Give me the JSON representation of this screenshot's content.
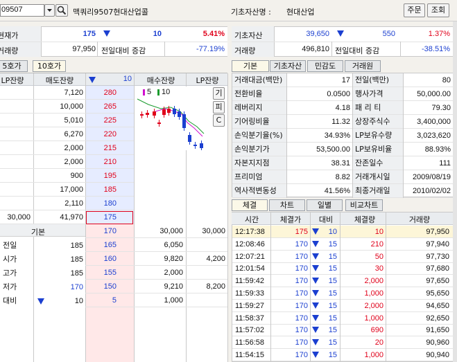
{
  "top": {
    "code": "09507",
    "name": "맥쿼리9507현대산업콜",
    "underlying_label": "기초자산명 :",
    "underlying_value": "현대산업",
    "btn_order": "주문",
    "btn_inquiry": "조회"
  },
  "left_info": {
    "price_label": "현재가",
    "price": "175",
    "change": "10",
    "rate": "5.41%",
    "volume_label": "거래량",
    "volume": "97,950",
    "prev_label": "전일대비 증감",
    "prev_rate": "-77.19%"
  },
  "right_info": {
    "asset_label": "기초자산",
    "asset_price": "39,650",
    "asset_change": "550",
    "asset_rate": "1.37%",
    "volume_label": "거래량",
    "volume": "496,810",
    "prev_label": "전일대비 증감",
    "prev_rate": "-38.51%"
  },
  "hoga_tabs": [
    "5호가",
    "10호가"
  ],
  "orderbook": {
    "headers": [
      "LP잔량",
      "매도잔량",
      "10",
      "매수잔량",
      "LP잔량"
    ],
    "asks": [
      {
        "lp": "",
        "qty": "7,120",
        "price": "280"
      },
      {
        "lp": "",
        "qty": "10,000",
        "price": "265"
      },
      {
        "lp": "",
        "qty": "5,010",
        "price": "225"
      },
      {
        "lp": "",
        "qty": "6,270",
        "price": "220"
      },
      {
        "lp": "",
        "qty": "2,000",
        "price": "215"
      },
      {
        "lp": "",
        "qty": "2,000",
        "price": "210"
      },
      {
        "lp": "",
        "qty": "900",
        "price": "195"
      },
      {
        "lp": "",
        "qty": "17,000",
        "price": "185"
      },
      {
        "lp": "",
        "qty": "2,110",
        "price": "180"
      },
      {
        "lp": "30,000",
        "qty": "41,970",
        "price": "175"
      }
    ],
    "bids": [
      {
        "price": "170",
        "qty": "30,000",
        "lp": "30,000"
      },
      {
        "price": "165",
        "qty": "6,050",
        "lp": ""
      },
      {
        "price": "160",
        "qty": "9,820",
        "lp": "4,200"
      },
      {
        "price": "155",
        "qty": "2,000",
        "lp": ""
      },
      {
        "price": "150",
        "qty": "9,210",
        "lp": "8,200"
      },
      {
        "price": "5",
        "qty": "1,000",
        "lp": ""
      }
    ],
    "basic_label": "기본",
    "basic_rows": [
      {
        "label": "전일",
        "value": "185"
      },
      {
        "label": "시가",
        "value": "185"
      },
      {
        "label": "고가",
        "value": "185"
      },
      {
        "label": "저가",
        "value": "170"
      },
      {
        "label": "대비",
        "value": "10"
      }
    ],
    "mini_legend_5": "5",
    "mini_legend_10": "10",
    "side_buttons": [
      "기",
      "피",
      "C"
    ]
  },
  "info_tabs": [
    "기본",
    "기초자산",
    "민감도",
    "거래원"
  ],
  "info_table": [
    {
      "l1": "거래대금(백만)",
      "v1": "17",
      "l2": "전일(백만)",
      "v2": "80"
    },
    {
      "l1": "전환비율",
      "v1": "0.0500",
      "l2": "행사가격",
      "v2": "50,000.00"
    },
    {
      "l1": "레버리지",
      "v1": "4.18",
      "l2": "패 리 티",
      "v2": "79.30"
    },
    {
      "l1": "기어링비율",
      "v1": "11.32",
      "l2": "상장주식수",
      "v2": "3,400,000"
    },
    {
      "l1": "손익분기율(%)",
      "v1": "34.93%",
      "l2": "LP보유수량",
      "v2": "3,023,620"
    },
    {
      "l1": "손익분기가",
      "v1": "53,500.00",
      "l2": "LP보유비율",
      "v2": "88.93%"
    },
    {
      "l1": "자본지지점",
      "v1": "38.31",
      "l2": "잔존일수",
      "v2": "111"
    },
    {
      "l1": "프리미엄",
      "v1": "8.82",
      "l2": "거래개시일",
      "v2": "2009/08/19"
    },
    {
      "l1": "역사적변동성",
      "v1": "41.56%",
      "l2": "최종거래일",
      "v2": "2010/02/02"
    }
  ],
  "trade_tabs": [
    "체결",
    "차트",
    "일별",
    "비교차트"
  ],
  "trades": {
    "headers": [
      "시간",
      "체결가",
      "대비",
      "체결량",
      "거래량"
    ],
    "rows": [
      {
        "time": "12:17:38",
        "price": "175",
        "chg": "10",
        "qty": "10",
        "vol": "97,950"
      },
      {
        "time": "12:08:46",
        "price": "170",
        "chg": "15",
        "qty": "210",
        "vol": "97,940"
      },
      {
        "time": "12:07:21",
        "price": "170",
        "chg": "15",
        "qty": "50",
        "vol": "97,730"
      },
      {
        "time": "12:01:54",
        "price": "170",
        "chg": "15",
        "qty": "30",
        "vol": "97,680"
      },
      {
        "time": "11:59:42",
        "price": "170",
        "chg": "15",
        "qty": "2,000",
        "vol": "97,650"
      },
      {
        "time": "11:59:33",
        "price": "170",
        "chg": "15",
        "qty": "1,000",
        "vol": "95,650"
      },
      {
        "time": "11:59:27",
        "price": "170",
        "chg": "15",
        "qty": "2,000",
        "vol": "94,650"
      },
      {
        "time": "11:58:37",
        "price": "170",
        "chg": "15",
        "qty": "1,000",
        "vol": "92,650"
      },
      {
        "time": "11:57:02",
        "price": "170",
        "chg": "15",
        "qty": "690",
        "vol": "91,650"
      },
      {
        "time": "11:56:58",
        "price": "170",
        "chg": "15",
        "qty": "20",
        "vol": "90,960"
      },
      {
        "time": "11:54:15",
        "price": "170",
        "chg": "15",
        "qty": "1,000",
        "vol": "90,940"
      }
    ]
  },
  "colors": {
    "up": "#e0001a",
    "down": "#1b3fd0",
    "ask_bg": "#ffe8e8",
    "bid_bg": "#e6ecff"
  }
}
